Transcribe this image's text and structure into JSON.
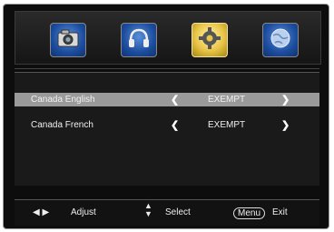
{
  "top_tabs": [
    {
      "icon": "camera-icon"
    },
    {
      "icon": "headphones-icon"
    },
    {
      "icon": "gear-icon"
    },
    {
      "icon": "globe-icon"
    }
  ],
  "rows": [
    {
      "label": "Canada English",
      "value": "EXEMPT"
    },
    {
      "label": "Canada French",
      "value": "EXEMPT"
    }
  ],
  "footer": {
    "adjust_label": "Adjust",
    "select_label": "Select",
    "menu_key": "Menu",
    "exit_label": "Exit"
  }
}
